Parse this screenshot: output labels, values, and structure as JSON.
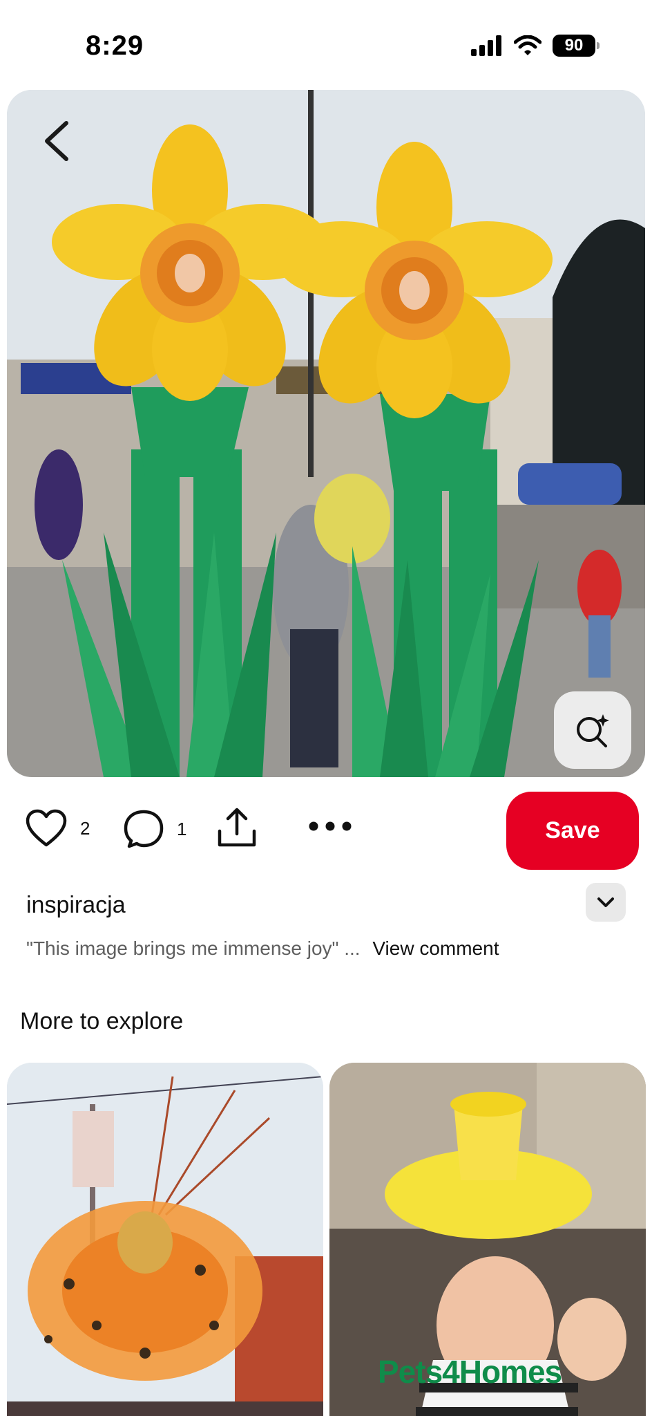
{
  "status_bar": {
    "time": "8:29",
    "battery": "90"
  },
  "pin": {
    "image_icon": "daffodil-costume-photo",
    "back_icon": "chevron-left-icon",
    "lens_icon": "visual-search-icon"
  },
  "actions": {
    "likes": "2",
    "comments": "1",
    "save_label": "Save"
  },
  "board": {
    "name": "inspiracja"
  },
  "comment": {
    "text": "\"This image brings me immense joy\" ...",
    "link": "View comment"
  },
  "more": {
    "title": "More to explore",
    "cards": [
      {
        "image_icon": "orange-flower-costume-photo"
      },
      {
        "image_icon": "daffodil-hat-photo",
        "watermark": "Pets4Homes"
      }
    ]
  },
  "colors": {
    "save": "#e60023",
    "watermark": "#0f8c4a"
  }
}
